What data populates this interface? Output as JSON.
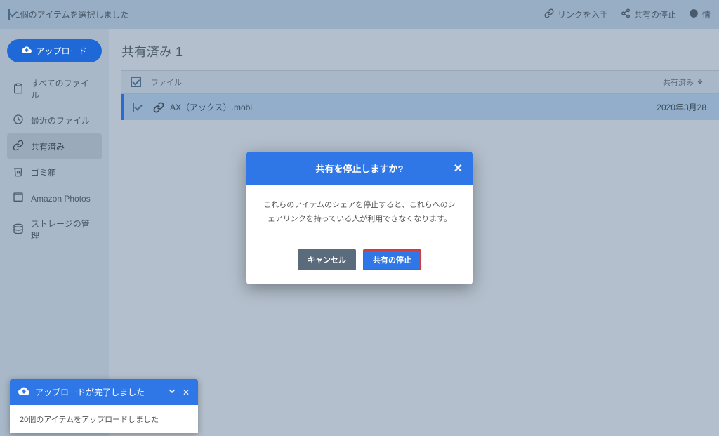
{
  "topbar": {
    "selection_label": "1個のアイテムを選択しました",
    "get_link_label": "リンクを入手",
    "stop_sharing_label": "共有の停止",
    "info_label": "情"
  },
  "sidebar": {
    "upload_label": "アップロード",
    "items": [
      {
        "label": "すべてのファイル"
      },
      {
        "label": "最近のファイル"
      },
      {
        "label": "共有済み"
      },
      {
        "label": "ゴミ箱"
      },
      {
        "label": "Amazon Photos"
      },
      {
        "label": "ストレージの管理"
      }
    ]
  },
  "main": {
    "page_title": "共有済み  1",
    "col_file": "ファイル",
    "col_shared": "共有済み",
    "row": {
      "filename": "AX（アックス）.mobi",
      "date": "2020年3月28"
    }
  },
  "modal": {
    "title": "共有を停止しますか?",
    "body": "これらのアイテムのシェアを停止すると、これらへのシェアリンクを持っている人が利用できなくなります。",
    "cancel": "キャンセル",
    "confirm": "共有の停止"
  },
  "toast": {
    "title": "アップロードが完了しました",
    "body": "20個のアイテムをアップロードしました"
  }
}
